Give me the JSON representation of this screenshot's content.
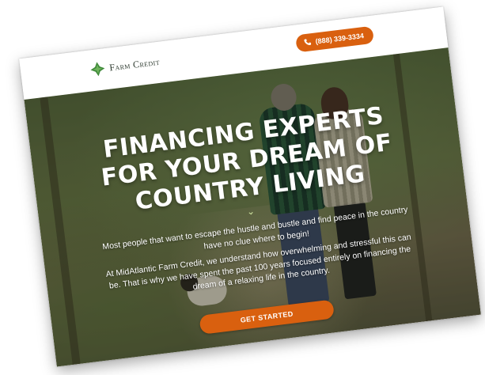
{
  "header": {
    "logo_text": "Farm Credit",
    "logo_icon": "diamond-leaf-icon",
    "phone_label": "(888) 339-3334",
    "phone_icon": "phone-icon"
  },
  "hero": {
    "headline_line1": "FINANCING EXPERTS",
    "headline_line2": "FOR YOUR DREAM OF",
    "headline_line3": "COUNTRY LIVING",
    "paragraph1": "Most people that want to escape the hustle and bustle and find peace in the country have no clue where to begin!",
    "paragraph2": "At MidAtlantic Farm Credit, we understand how overwhelming and stressful this can be. That is why we have spent the past 100 years focused entirely on financing the dream of a relaxing life in the country.",
    "cta_label": "GET STARTED",
    "scroll_icon": "chevron-down-icon"
  },
  "colors": {
    "accent": "#d9600f",
    "logo_green": "#3f8a3a",
    "text_dark": "#2d3a2f"
  }
}
